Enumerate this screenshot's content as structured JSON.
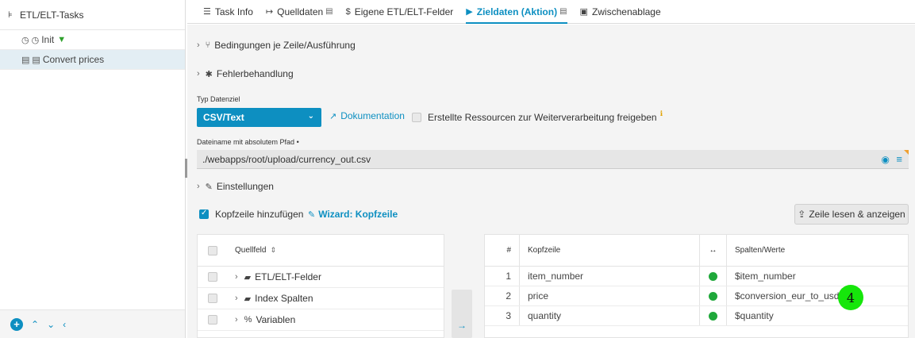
{
  "left_panel": {
    "title": "ETL/ELT-Tasks",
    "items": [
      {
        "label": "Init",
        "selected": false
      },
      {
        "label": "Convert prices",
        "selected": true
      }
    ]
  },
  "tabs": [
    {
      "label": "Task Info",
      "icon": "list-icon"
    },
    {
      "label": "Quelldaten",
      "icon": "import-icon"
    },
    {
      "label": "Eigene ETL/ELT-Felder",
      "icon": "dollar-icon"
    },
    {
      "label": "Zieldaten (Aktion)",
      "icon": "play-icon",
      "active": true
    },
    {
      "label": "Zwischenablage",
      "icon": "clipboard-icon"
    }
  ],
  "sections": {
    "conditions": "Bedingungen je Zeile/Ausführung",
    "errors": "Fehlerbehandlung",
    "settings": "Einstellungen"
  },
  "target_type": {
    "label": "Typ Datenziel",
    "value": "CSV/Text",
    "doc_link": "Dokumentation",
    "release_checkbox": "Erstellte Ressourcen zur Weiterverarbeitung freigeben",
    "release_checked": false
  },
  "filename": {
    "label": "Dateiname mit absolutem Pfad",
    "required_marker": "•",
    "value": "./webapps/root/upload/currency_out.csv"
  },
  "header_row": {
    "checkbox_label": "Kopfzeile hinzufügen",
    "checked": true,
    "wizard": "Wizard: Kopfzeile",
    "read_button": "Zeile lesen & anzeigen"
  },
  "source_table": {
    "header": "Quellfeld",
    "rows": [
      {
        "label": "ETL/ELT-Felder",
        "icon": "folder-icon"
      },
      {
        "label": "Index Spalten",
        "icon": "folder-icon"
      },
      {
        "label": "Variablen",
        "icon": "percent-icon"
      }
    ]
  },
  "target_table": {
    "headers": {
      "num": "#",
      "header": "Kopfzeile",
      "map": "↔",
      "values": "Spalten/Werte"
    },
    "rows": [
      {
        "num": "1",
        "header": "item_number",
        "value": "$item_number"
      },
      {
        "num": "2",
        "header": "price",
        "value": "$conversion_eur_to_usd"
      },
      {
        "num": "3",
        "header": "quantity",
        "value": "$quantity"
      }
    ]
  },
  "badge": "4",
  "colors": {
    "accent": "#0d8fc1",
    "status_ok": "#1fa83a",
    "badge": "#16e60b"
  }
}
